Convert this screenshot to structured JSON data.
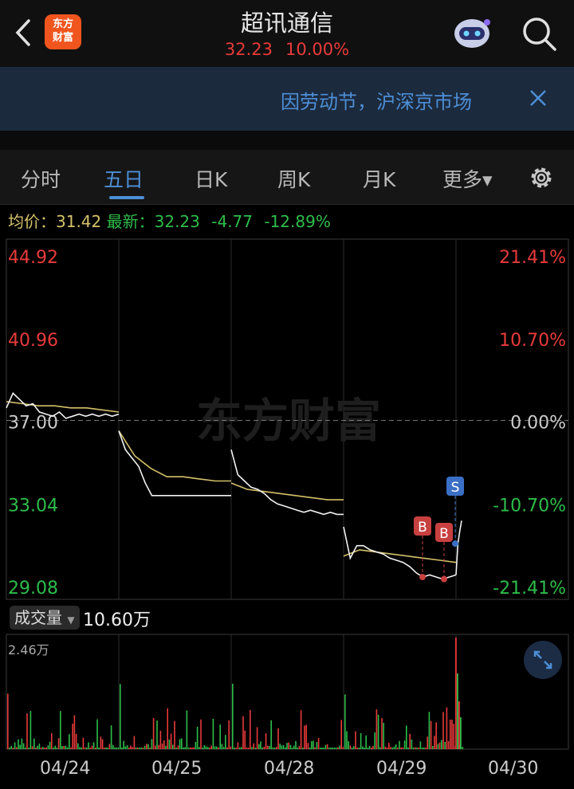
{
  "header": {
    "logo_line1": "东方",
    "logo_line2": "财富",
    "title": "超讯通信",
    "price": "32.23",
    "change_pct": "10.00%"
  },
  "banner": {
    "text": "因劳动节，沪深京市场"
  },
  "tabs": [
    {
      "label": "分时"
    },
    {
      "label": "五日",
      "active": true
    },
    {
      "label": "日K"
    },
    {
      "label": "周K"
    },
    {
      "label": "月K"
    },
    {
      "label": "更多▾"
    }
  ],
  "info": {
    "avg_label": "均价：",
    "avg_value": "31.42",
    "latest_label": "最新：",
    "latest_value": "32.23",
    "change": "-4.77",
    "change_pct": "-12.89%"
  },
  "watermark": "东方财富",
  "volume": {
    "label": "成交量",
    "value": "10.60万",
    "max_label": "2.46万"
  },
  "markers": [
    "B",
    "B",
    "S"
  ],
  "chart_data": {
    "type": "line",
    "title": "",
    "price_ticks": [
      "44.92",
      "40.96",
      "37.00",
      "33.04",
      "29.08"
    ],
    "pct_ticks": [
      "21.41%",
      "10.70%",
      "0.00%",
      "-10.70%",
      "-21.41%"
    ],
    "dates": [
      "04/24",
      "04/25",
      "04/28",
      "04/29",
      "04/30"
    ],
    "ylim": [
      29.08,
      44.92
    ],
    "prev_close": 37.0,
    "series": [
      {
        "days": [
          [
            37.6,
            38.3,
            38.0,
            37.7,
            37.8,
            37.4,
            37.3,
            37.2,
            37.4,
            37.1,
            37.2,
            37.3,
            37.2,
            37.3,
            37.2,
            37.3,
            37.2,
            37.3
          ],
          [
            36.5,
            35.6,
            35.2,
            34.8,
            34.0,
            33.4,
            33.4,
            33.4,
            33.4,
            33.4,
            33.4,
            33.4,
            33.4,
            33.4,
            33.4,
            33.4,
            33.4,
            33.4
          ],
          [
            35.6,
            34.4,
            34.1,
            33.8,
            33.7,
            33.5,
            33.2,
            33.0,
            32.9,
            32.8,
            32.7,
            32.6,
            32.7,
            32.6,
            32.5,
            32.6,
            32.5,
            32.5
          ],
          [
            31.9,
            30.4,
            31.0,
            31.0,
            30.8,
            30.7,
            30.6,
            30.4,
            30.3,
            30.2,
            30.0,
            29.7,
            29.5,
            29.6,
            29.5,
            29.4,
            29.5,
            29.6
          ],
          [
            29.6,
            31.1,
            31.7,
            32.2
          ]
        ],
        "color": "#ffffff"
      },
      {
        "days": [
          [
            37.9,
            37.8,
            37.7,
            37.7,
            37.6,
            37.6,
            37.5,
            37.4
          ],
          [
            36.5,
            35.3,
            34.7,
            34.3,
            34.3,
            34.2,
            34.1,
            34.1
          ],
          [
            34.0,
            33.7,
            33.6,
            33.5,
            33.4,
            33.3,
            33.2,
            33.2
          ],
          [
            30.5,
            30.8,
            30.7,
            30.6,
            30.5,
            30.4,
            30.3,
            30.2
          ],
          [
            30.1
          ]
        ],
        "color": "#d4c16a"
      }
    ],
    "volume_max": 24600
  },
  "colors": {
    "up": "#e83a3a",
    "down": "#2ebd4a",
    "accent": "#4d8ed6",
    "avg": "#d4c16a"
  }
}
